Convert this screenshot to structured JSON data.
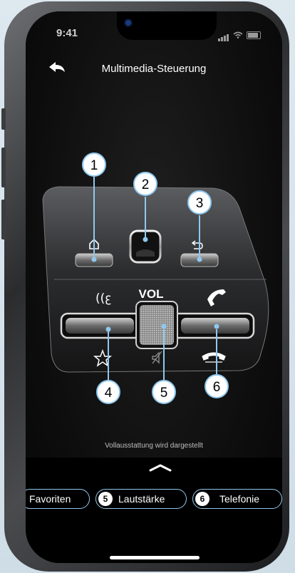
{
  "status": {
    "time": "9:41"
  },
  "header": {
    "title": "Multimedia-Steuerung"
  },
  "wheel": {
    "vol_label": "VOL",
    "callouts": [
      "1",
      "2",
      "3",
      "4",
      "5",
      "6"
    ]
  },
  "note": "Vollausstattung wird dargestellt",
  "chips": [
    {
      "label": "Favoriten",
      "num": ""
    },
    {
      "label": "Lautstärke",
      "num": "5"
    },
    {
      "label": "Telefonie",
      "num": "6"
    }
  ],
  "colors": {
    "accent": "#8fc8ee",
    "background": "#000000"
  }
}
